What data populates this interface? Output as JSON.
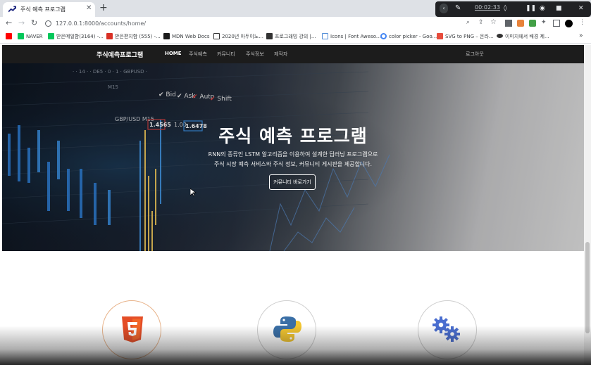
{
  "browser": {
    "tab_title": "주식 예측 프로그램",
    "tab_close": "✕",
    "new_tab": "+",
    "url": "127.0.0.1:8000/accounts/home/",
    "recorder_time": "00:02:33",
    "bookmarks": [
      {
        "label": "",
        "icon": "youtube-icon",
        "color": "#ff0000"
      },
      {
        "label": "NAVER",
        "icon": "naver-icon",
        "color": "#03c75a"
      },
      {
        "label": "받은메일함(3164) -...",
        "icon": "naver-mail-icon",
        "color": "#03c75a"
      },
      {
        "label": "받은편지함 (555) -...",
        "icon": "gmail-icon",
        "color": "#d93025"
      },
      {
        "label": "MDN Web Docs",
        "icon": "mdn-icon",
        "color": "#1b1b1b"
      },
      {
        "label": "2020년 아두이노...",
        "icon": "arduino-icon",
        "color": "#333333"
      },
      {
        "label": "프로그래밍 강의 |...",
        "icon": "bookmark-icon",
        "color": "#333333"
      },
      {
        "label": "Icons | Font Aweso...",
        "icon": "flag-icon",
        "color": "#528dd7"
      },
      {
        "label": "color picker - Goo...",
        "icon": "google-icon",
        "color": "#4285f4"
      },
      {
        "label": "SVG to PNG – 온라...",
        "icon": "svg-png-icon",
        "color": "#e74c3c"
      },
      {
        "label": "이미지에서 배경 제...",
        "icon": "eye-icon",
        "color": "#333333"
      }
    ],
    "bookmarks_more": "»"
  },
  "site": {
    "brand": "주식예측프로그램",
    "nav": [
      "HOME",
      "주식예측",
      "커뮤니티",
      "주식정보",
      "제작자"
    ],
    "logout": "로그아웃"
  },
  "hero": {
    "title": "주식 예측 프로그램",
    "desc_line1": "RNN의 종류인 LSTM 알고리즘을 이용하여 설계한 딥러닝 프로그램으로",
    "desc_line2": "주식 시장 예측 서비스와 주식 정보, 커뮤니티 게시판을 제공합니다.",
    "button": "커뮤니티 바로가기",
    "background_texts": [
      "Bid",
      "Ask",
      "Auto",
      "Shift",
      "GBP/USD M15",
      "1.4565",
      "1.00",
      "1.6478"
    ]
  },
  "features": {
    "icons": [
      "html5-icon",
      "python-icon",
      "gears-icon"
    ]
  },
  "colors": {
    "nav_bg": "#1c1c1c",
    "html5_orange": "#e44d26",
    "python_blue": "#3a6fa6",
    "python_yellow": "#f2c530",
    "gears_blue": "#4a6ed0"
  }
}
